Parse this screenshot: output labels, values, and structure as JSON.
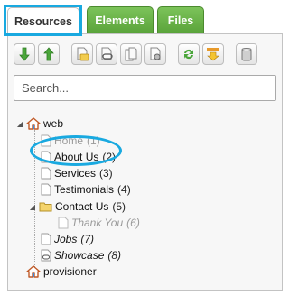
{
  "tabs": [
    {
      "label": "Resources",
      "active": true
    },
    {
      "label": "Elements",
      "active": false
    },
    {
      "label": "Files",
      "active": false
    }
  ],
  "toolbar": {
    "buttons": [
      {
        "icon": "arrow-down-icon"
      },
      {
        "icon": "arrow-up-icon"
      },
      {
        "icon": "new-folder-icon"
      },
      {
        "icon": "new-weblink-icon"
      },
      {
        "icon": "new-document-icon"
      },
      {
        "icon": "new-static-resource-icon"
      },
      {
        "icon": "refresh-icon"
      },
      {
        "icon": "sort-icon"
      },
      {
        "icon": "trash-icon"
      }
    ]
  },
  "search": {
    "placeholder": "Search...",
    "value": ""
  },
  "tree": {
    "contexts": [
      {
        "label": "web",
        "icon": "home-icon"
      },
      {
        "label": "provisioner",
        "icon": "home-icon"
      }
    ],
    "items": [
      {
        "label": "Home",
        "count": "(1)",
        "style": "unpublished"
      },
      {
        "label": "About Us",
        "count": "(2)",
        "style": "normal",
        "highlighted": true
      },
      {
        "label": "Services",
        "count": "(3)",
        "style": "normal"
      },
      {
        "label": "Testimonials",
        "count": "(4)",
        "style": "normal"
      },
      {
        "label": "Contact Us",
        "count": "(5)",
        "style": "folder"
      },
      {
        "label": "Thank You",
        "count": "(6)",
        "style": "hidden"
      },
      {
        "label": "Jobs",
        "count": "(7)",
        "style": "italic"
      },
      {
        "label": "Showcase",
        "count": "(8)",
        "style": "italic-link"
      }
    ]
  },
  "colors": {
    "highlight": "#19a9e0",
    "tab_green": "#6ab84a",
    "home_icon": "#c05a28"
  }
}
